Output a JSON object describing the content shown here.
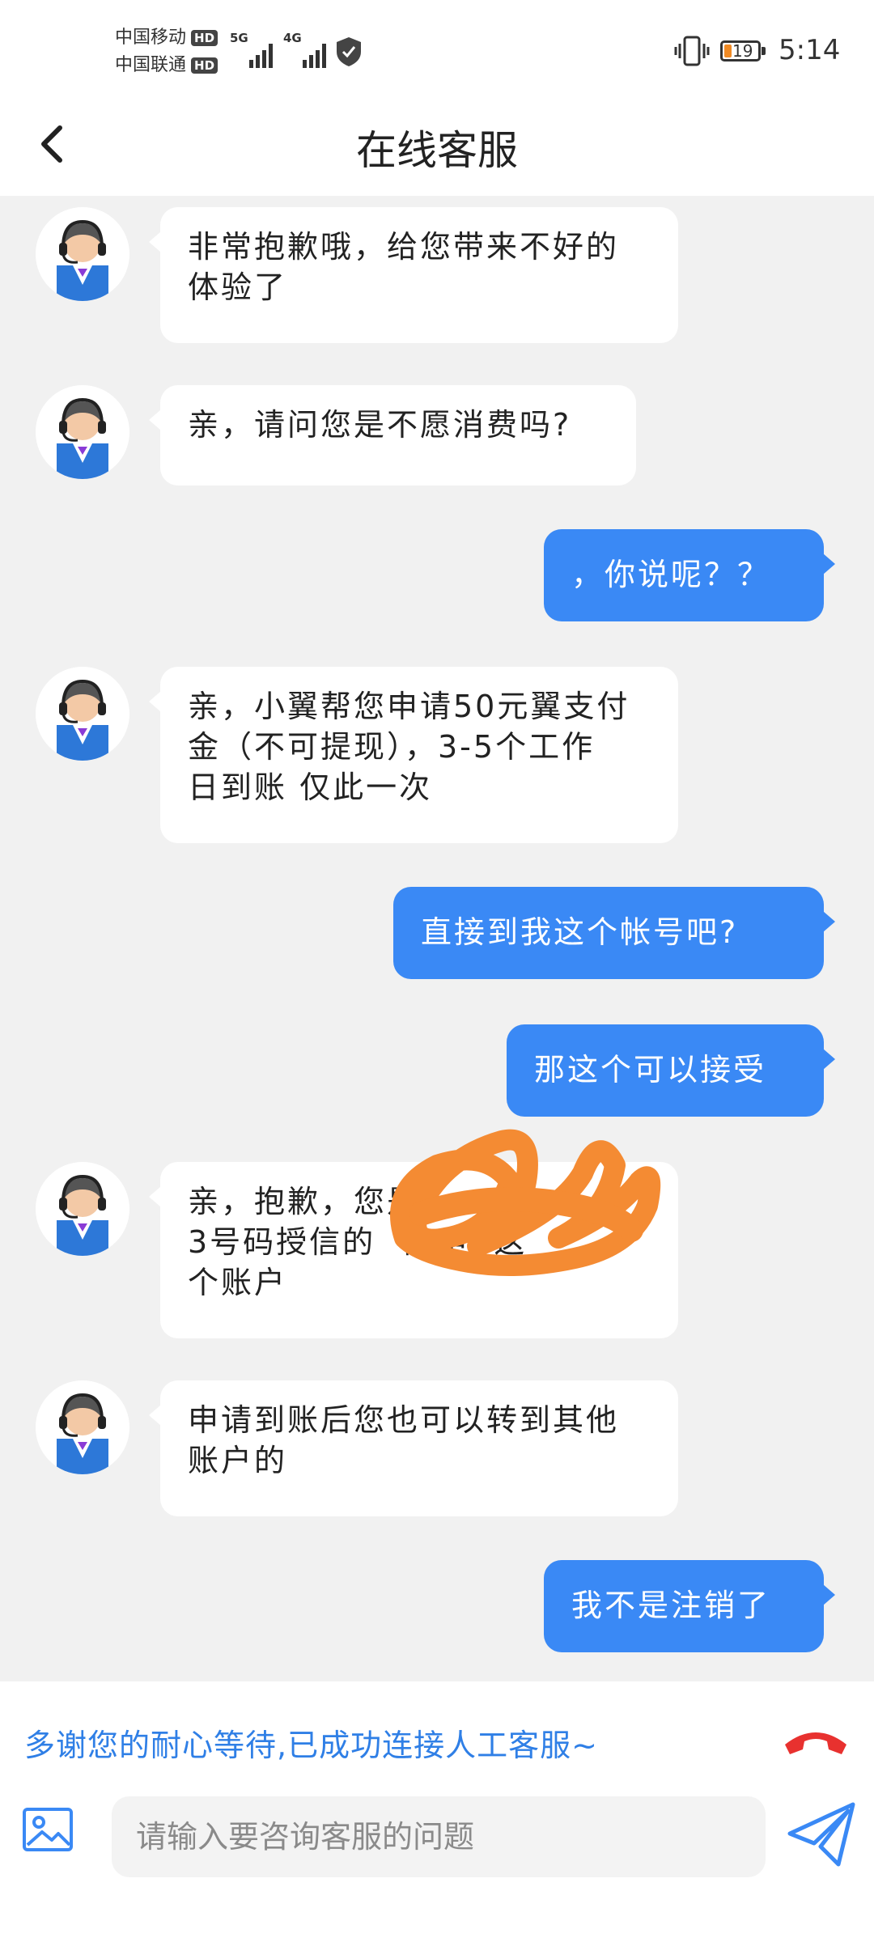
{
  "status_bar": {
    "carrier_1": "中国移动",
    "carrier_2": "中国联通",
    "hd_badge": "HD",
    "network_1": "5G",
    "network_2": "4G",
    "battery_level": "19",
    "time": "5:14"
  },
  "header": {
    "title": "在线客服"
  },
  "messages": [
    {
      "side": "agent",
      "text_1": "非常抱歉哦，给您带来不好的",
      "text_2": "体验了"
    },
    {
      "side": "agent",
      "text_1": "亲，请问您是不愿消费吗?"
    },
    {
      "side": "user",
      "text_1": "，你说呢？？"
    },
    {
      "side": "agent",
      "text_1": "亲，小翼帮您申请50元翼支付",
      "text_2": "金（不可提现），3-5个工作",
      "text_3": "日到账 仅此一次"
    },
    {
      "side": "user",
      "text_1": "直接到我这个帐号吧?"
    },
    {
      "side": "user",
      "text_1": "那这个可以接受"
    },
    {
      "side": "agent",
      "text_1": "亲，抱歉，您是1",
      "text_2": "3号码授信的",
      "text_3": "能申",
      "text_4": "这",
      "text_5": "个账户"
    },
    {
      "side": "agent",
      "text_1": "申请到账后您也可以转到其他",
      "text_2": "账户的"
    },
    {
      "side": "user",
      "text_1": "我不是注销了"
    }
  ],
  "footer": {
    "notice": "多谢您的耐心等待,已成功连接人工客服~",
    "input_placeholder": "请输入要咨询客服的问题"
  },
  "icons": {
    "back": "chevron-left-icon",
    "hangup": "phone-hangup-icon",
    "image": "image-icon",
    "send": "send-icon"
  },
  "colors": {
    "user_bubble": "#3a89f5",
    "agent_bubble": "#ffffff",
    "chat_background": "#f1f1f1",
    "notice_text": "#2f7fe6",
    "hangup_icon": "#e8312f",
    "redaction": "#f48b33"
  }
}
